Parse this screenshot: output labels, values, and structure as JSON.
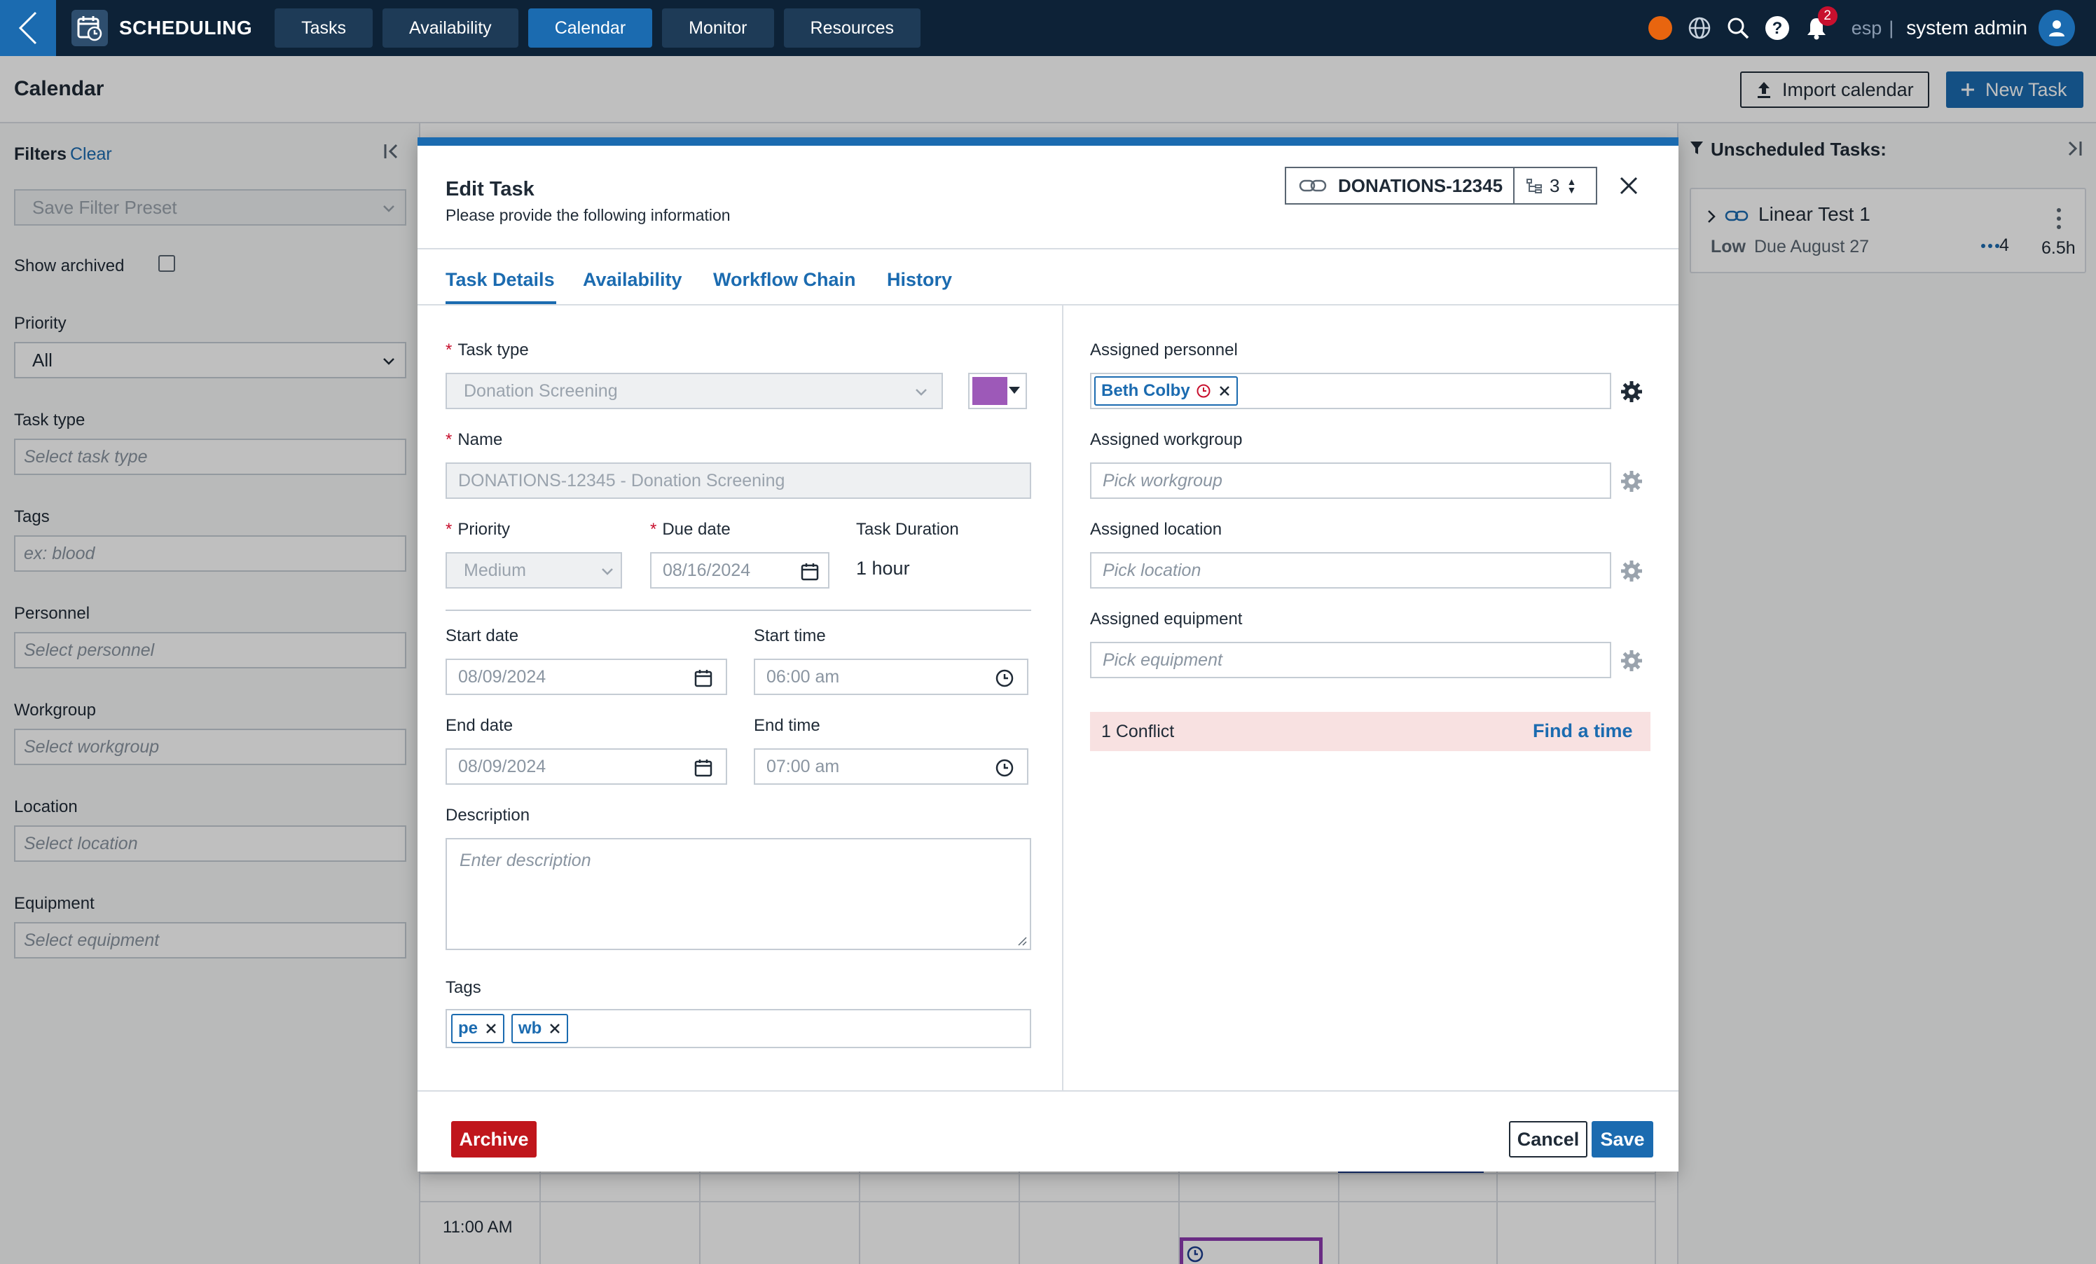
{
  "nav": {
    "app_title": "SCHEDULING",
    "tabs": [
      "Tasks",
      "Availability",
      "Calendar",
      "Monitor",
      "Resources"
    ],
    "active_tab": "Calendar",
    "notification_count": "2",
    "language": "esp",
    "separator": "|",
    "user_name": "system admin"
  },
  "page": {
    "title": "Calendar",
    "import_label": "Import calendar",
    "new_task_label": "New Task"
  },
  "filters": {
    "title": "Filters",
    "clear": "Clear",
    "preset_placeholder": "Save Filter Preset",
    "show_archived": "Show archived",
    "priority_label": "Priority",
    "priority_value": "All",
    "task_type_label": "Task type",
    "task_type_placeholder": "Select task type",
    "tags_label": "Tags",
    "tags_placeholder": "ex: blood",
    "personnel_label": "Personnel",
    "personnel_placeholder": "Select personnel",
    "workgroup_label": "Workgroup",
    "workgroup_placeholder": "Select workgroup",
    "location_label": "Location",
    "location_placeholder": "Select location",
    "equipment_label": "Equipment",
    "equipment_placeholder": "Select equipment"
  },
  "unscheduled": {
    "title": "Unscheduled Tasks:",
    "task": {
      "name": "Linear Test 1",
      "priority": "Low",
      "due": "Due August 27",
      "count": "4",
      "hours": "6.5h"
    }
  },
  "calendar": {
    "time_label": "11:00 AM"
  },
  "modal": {
    "title": "Edit Task",
    "subtitle": "Please provide the following information",
    "task_id": "DONATIONS-12345",
    "chain_count": "3",
    "tabs": [
      "Task Details",
      "Availability",
      "Workflow Chain",
      "History"
    ],
    "task_type_label": "Task type",
    "task_type_value": "Donation Screening",
    "task_color": "#9d59b8",
    "name_label": "Name",
    "name_value": "DONATIONS-12345 - Donation Screening",
    "priority_label": "Priority",
    "priority_value": "Medium",
    "due_date_label": "Due date",
    "due_date_value": "08/16/2024",
    "duration_label": "Task Duration",
    "duration_value": "1 hour",
    "start_date_label": "Start date",
    "start_date_value": "08/09/2024",
    "start_time_label": "Start time",
    "start_time_value": "06:00 am",
    "end_date_label": "End date",
    "end_date_value": "08/09/2024",
    "end_time_label": "End time",
    "end_time_value": "07:00 am",
    "description_label": "Description",
    "description_placeholder": "Enter description",
    "tags_label": "Tags",
    "tags": [
      "pe",
      "wb"
    ],
    "personnel_label": "Assigned personnel",
    "personnel_chip": "Beth Colby",
    "workgroup_label": "Assigned workgroup",
    "workgroup_placeholder": "Pick workgroup",
    "location_label": "Assigned location",
    "location_placeholder": "Pick location",
    "equipment_label": "Assigned equipment",
    "equipment_placeholder": "Pick equipment",
    "conflict_text": "1 Conflict",
    "find_time_label": "Find a time",
    "archive_label": "Archive",
    "cancel_label": "Cancel",
    "save_label": "Save"
  },
  "colors": {
    "accent": "#1b6bb0",
    "nav_bg": "#0d2237",
    "danger": "#c0161c",
    "conflict_bg": "#f8e1e1"
  }
}
